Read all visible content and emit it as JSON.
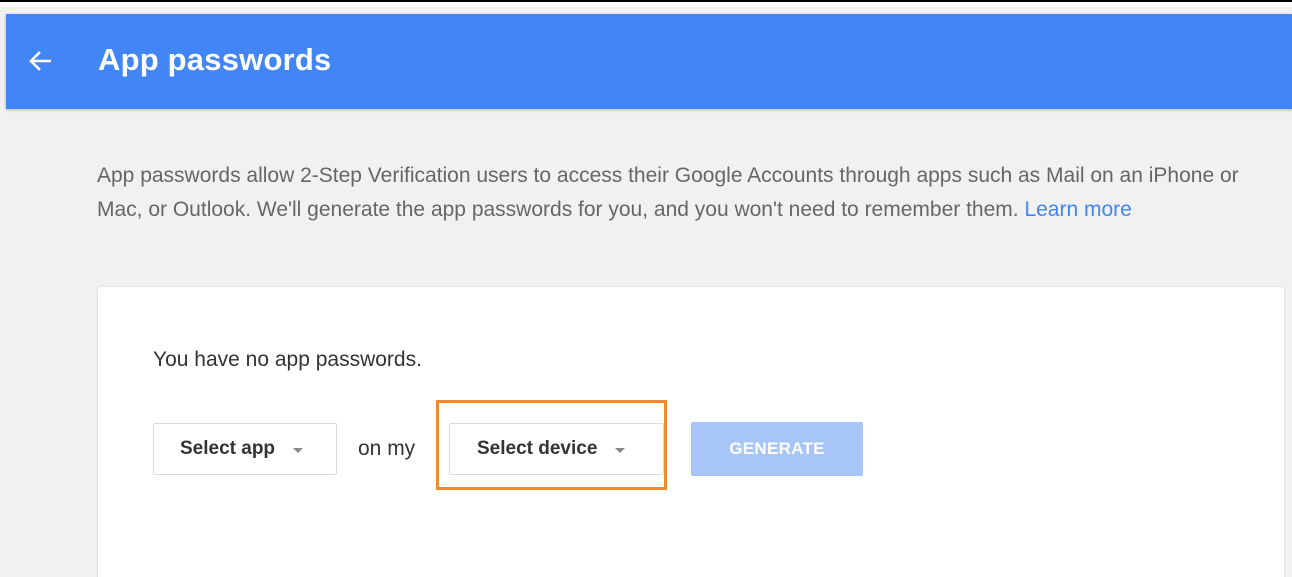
{
  "colors": {
    "appbar_blue": "#4285f4",
    "link_blue": "#4285f4",
    "highlight_orange": "#f4892f",
    "button_disabled_blue": "#a7c5f9"
  },
  "appbar": {
    "back_icon": "arrow-back-icon",
    "title": "App passwords"
  },
  "intro": {
    "text": "App passwords allow 2-Step Verification users to access their Google Accounts through apps such as Mail on an iPhone or Mac, or Outlook. We'll generate the app passwords for you, and you won't need to remember them. ",
    "link_text": "Learn more"
  },
  "card": {
    "empty_message": "You have no app passwords.",
    "select_app": {
      "label": "Select app",
      "icon": "dropdown-caret-icon"
    },
    "connector_text": "on my",
    "select_device": {
      "label": "Select device",
      "icon": "dropdown-caret-icon"
    },
    "generate_button": {
      "label": "GENERATE",
      "state": "disabled"
    }
  }
}
